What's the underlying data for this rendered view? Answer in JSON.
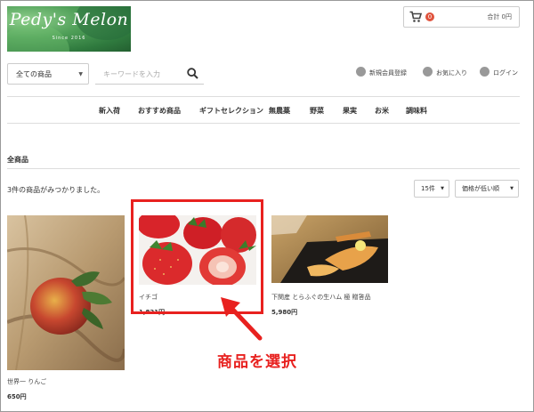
{
  "header": {
    "logo_title": "Pedy's Melon",
    "logo_sub": "Since 2016",
    "cart_count": "0",
    "cart_total": "合計 0円"
  },
  "search": {
    "category_selected": "全ての商品",
    "placeholder": "キーワードを入力"
  },
  "util_links": {
    "register": "新規会員登録",
    "favorites": "お気に入り",
    "login": "ログイン"
  },
  "nav": [
    "新入荷",
    "おすすめ商品",
    "ギフトセレクション",
    "無農薬",
    "野菜",
    "果実",
    "お米",
    "調味料"
  ],
  "listing": {
    "title": "全商品",
    "count_text": "3件の商品がみつかりました。",
    "per_page": "15件",
    "sort": "価格が低い順"
  },
  "products": [
    {
      "name": "世界一 りんご",
      "price": "650円"
    },
    {
      "name": "イチゴ",
      "price": "1,821円"
    },
    {
      "name": "下関産 とらふぐの生ハム 極 贈答品",
      "price": "5,980円"
    }
  ],
  "annotation": {
    "label": "商品を選択",
    "color": "#e8211f"
  },
  "icons": [
    "cart-icon",
    "search-icon",
    "user-icon",
    "heart-icon",
    "lock-icon"
  ]
}
